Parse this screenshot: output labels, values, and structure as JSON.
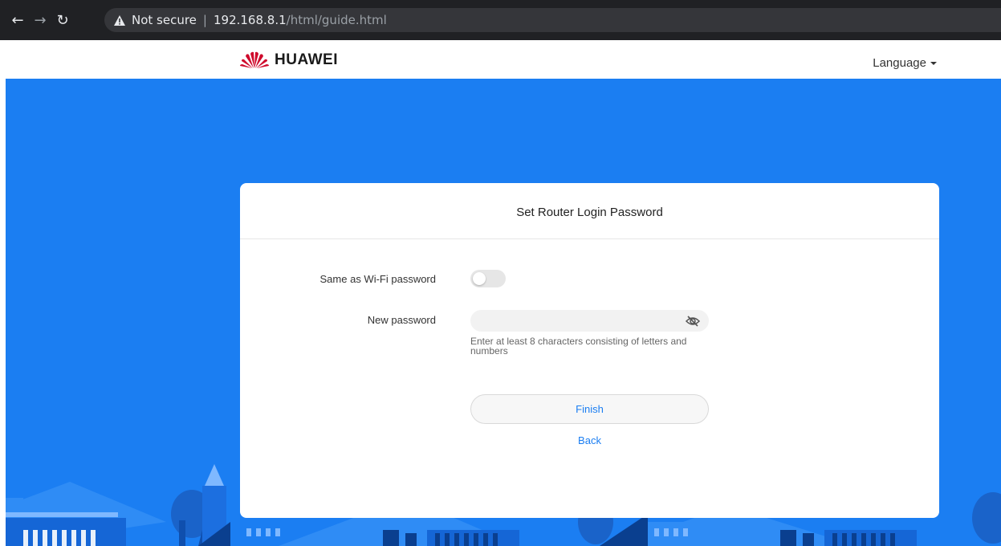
{
  "browser": {
    "security_label": "Not secure",
    "url_host": "192.168.8.1",
    "url_path": "/html/guide.html"
  },
  "header": {
    "brand": "HUAWEI",
    "language_label": "Language"
  },
  "card": {
    "title": "Set Router Login Password",
    "same_as_wifi_label": "Same as Wi-Fi password",
    "same_as_wifi_enabled": false,
    "new_password_label": "New password",
    "new_password_value": "",
    "hint": "Enter at least 8 characters consisting of letters and numbers",
    "finish_label": "Finish",
    "back_label": "Back"
  },
  "colors": {
    "accent": "#1b7ef2",
    "brand_red": "#cf0a2c",
    "browser_bar": "#202124"
  },
  "icons": {
    "back": "arrow-left-icon",
    "forward": "arrow-right-icon",
    "reload": "reload-icon",
    "warning": "warning-icon",
    "logo": "huawei-logo-icon",
    "password_visibility": "eye-off-icon"
  }
}
